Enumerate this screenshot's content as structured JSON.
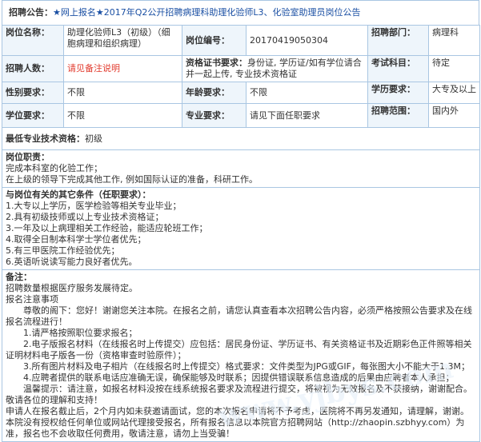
{
  "title": {
    "label": "招聘公告：",
    "text": "★网上报名★2017年Q2公开招聘病理科助理化验师L3、化验室助理员岗位公告"
  },
  "rows": {
    "position_name_label": "岗位名称：",
    "position_name_value": "助理化验师L3（初级）（细胞病理和组织病理）",
    "position_code_label": "岗位编号：",
    "position_code_value": "20170419050304",
    "dept_label": "招聘部门：",
    "dept_value": "病理科",
    "count_label": "招聘人数：",
    "count_value": "请见备注说明",
    "cert_label": "资格证书要求：",
    "cert_value": "身份证, 学历证/如有学位请合并一起上传, 专业技术资格证",
    "exam_label": "考试科目：",
    "exam_value": "待定",
    "gender_label": "性别要求：",
    "gender_value": "不限",
    "age_label": "年龄要求：",
    "age_value": "不限",
    "edu_label": "学历要求：",
    "edu_value": "大专及以上",
    "degree_label": "学位要求：",
    "degree_value": "不限",
    "major_label": "专业要求：",
    "major_value": "请见下面任职要求",
    "scope_label": "招聘范围：",
    "scope_value": "国内外",
    "tech_label": "最低专业技术资格：",
    "tech_value": "初级"
  },
  "duties": {
    "title": "岗位职责：",
    "lines": [
      "完成本科室的化验工作；",
      "在上级的领导下完成其他工作, 例如国际认证的准备，科研工作。"
    ]
  },
  "conditions": {
    "title": "与岗位有关的其它条件（任职要求）：",
    "lines": [
      "1.大专以上学历，医学检验等相关专业毕业；",
      "2.具有初级技师或以上专业技术资格证；",
      "3.一年及以上病理相关工作经验，能适应轮班工作；",
      "4.取得全日制本科学士学位者优先；",
      "5.有三甲医院工作经验优先；",
      "6.英语听说读写能力良好者优先。"
    ]
  },
  "notes": {
    "title": "备注：",
    "lines": [
      "招聘数量根据医疗服务发展待定。",
      "报名注意事项",
      "　　尊敬的阁下：您好！谢谢您关注本院。在报名之前，请您认真查看本次招聘公告内容，必须严格按照公告要求及在线报名流程进行！",
      "　　1.请严格按照职位要求报名；",
      "　　2.电子版报名材料（在线报名时上传提交）应包括：居民身份证、学历证书、有关资格证书及近期彩色正件照等相关证明材料电子版各一份（资格审查时验原件）；",
      "　　3.所有图片材料及电子相片（在线报名时上传提交）格式要求：文件类型为JPG或GIF，每张图大小不能大于1.3M；",
      "　　4.应聘者提供的联系电话应准确无误，确保能够及时联系；因提供错误联系信息造成的后果由应聘者本人承担；",
      "　　温馨提示：请注意，如报名材料没按在线系统报名要求及流程进行提交，将被视为无效报名及不获接纳，谢谢配合。敬请各位的理解和支持！",
      "申请人在报名截止后，2个月内如未获邀请面试，您的本次报名申请将不予考虑，医院将不再另发通知，请理解，谢谢。",
      "本院没有授权给任何单位或网站代理接受报名，所有报名信息以本院官方招聘网站（http://zhaopin.szbhyy.com）为准，报名也不会收取任何费用，敬请注意，请勿上当受骗！"
    ]
  },
  "watermark": "www.yjbys.com"
}
